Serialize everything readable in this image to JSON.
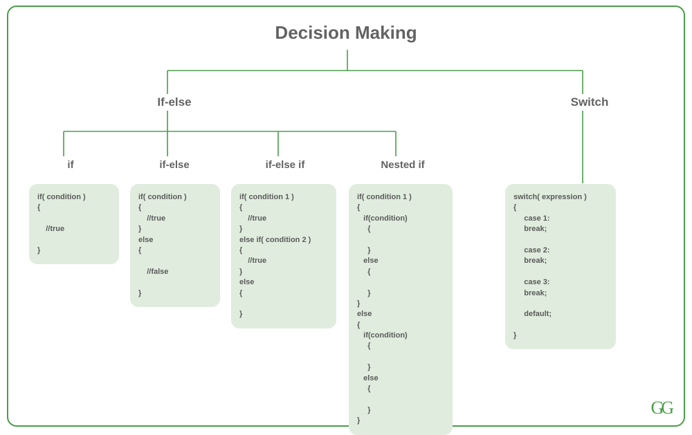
{
  "title": "Decision Making",
  "branches": {
    "ifelse": {
      "label": "If-else"
    },
    "switch": {
      "label": "Switch"
    }
  },
  "leaves": {
    "if": {
      "label": "if"
    },
    "ifelse2": {
      "label": "if-else"
    },
    "ifelseif": {
      "label": "if-else if"
    },
    "nestedif": {
      "label": "Nested if"
    }
  },
  "code": {
    "if": "if( condition )\n{\n\n    //true\n\n}",
    "ifelse": "if( condition )\n{\n    //true\n}\nelse\n{\n\n    //false\n\n}",
    "ifelseif": "if( condition 1 )\n{\n    //true\n}\nelse if( condition 2 )\n{\n    //true\n}\nelse\n{\n\n}",
    "nestedif": "if( condition 1 )\n{\n   if(condition)\n     {\n\n     }\n   else\n     {\n\n     }\n}\nelse\n{\n   if(condition)\n     {\n\n     }\n   else\n     {\n\n     }\n}",
    "switch": "switch( expression )\n{\n     case 1:\n     break;\n\n     case 2:\n     break;\n\n     case 3:\n     break;\n\n     default;\n\n}"
  },
  "logo": "GG",
  "colors": {
    "border": "#4a9d4a",
    "boxbg": "#e0edde",
    "text": "#636363"
  }
}
